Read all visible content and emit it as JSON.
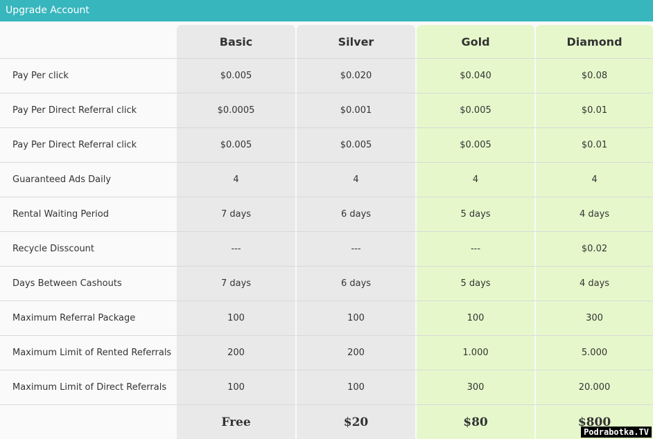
{
  "window": {
    "title": "Upgrade Account"
  },
  "plans": [
    "Basic",
    "Silver",
    "Gold",
    "Diamond"
  ],
  "rows": [
    {
      "label": "Pay Per click",
      "values": [
        "$0.005",
        "$0.020",
        "$0.040",
        "$0.08"
      ]
    },
    {
      "label": "Pay Per Direct Referral click",
      "values": [
        "$0.0005",
        "$0.001",
        "$0.005",
        "$0.01"
      ]
    },
    {
      "label": "Pay Per Direct Referral click",
      "values": [
        "$0.005",
        "$0.005",
        "$0.005",
        "$0.01"
      ]
    },
    {
      "label": "Guaranteed Ads Daily",
      "values": [
        "4",
        "4",
        "4",
        "4"
      ]
    },
    {
      "label": "Rental Waiting Period",
      "values": [
        "7 days",
        "6 days",
        "5 days",
        "4 days"
      ]
    },
    {
      "label": "Recycle Disscount",
      "values": [
        "---",
        "---",
        "---",
        "$0.02"
      ]
    },
    {
      "label": "Days Between Cashouts",
      "values": [
        "7 days",
        "6 days",
        "5 days",
        "4 days"
      ]
    },
    {
      "label": "Maximum Referral Package",
      "values": [
        "100",
        "100",
        "100",
        "300"
      ]
    },
    {
      "label": "Maximum Limit of Rented Referrals",
      "values": [
        "200",
        "200",
        "1.000",
        "5.000"
      ]
    },
    {
      "label": "Maximum Limit of Direct Referrals",
      "values": [
        "100",
        "100",
        "300",
        "20.000"
      ]
    }
  ],
  "prices": [
    "Free",
    "$20",
    "$80",
    "$800"
  ],
  "watermark": "Podrabotka.TV",
  "colors": {
    "titlebar": "#37b6bd",
    "standard_column": "#e9e9e9",
    "premium_column": "#e6f8cb"
  }
}
